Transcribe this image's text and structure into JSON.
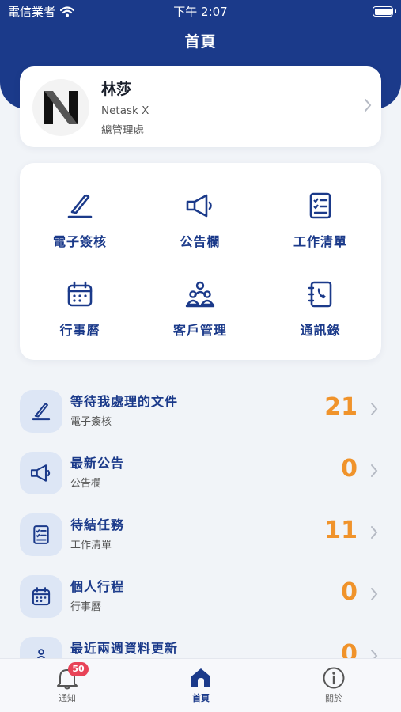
{
  "status_bar": {
    "carrier": "電信業者",
    "time": "下午 2:07"
  },
  "nav": {
    "title": "首頁"
  },
  "profile": {
    "name": "林莎",
    "company": "Netask X",
    "department": "總管理處"
  },
  "shortcuts": [
    {
      "label": "電子簽核",
      "icon": "pen-icon"
    },
    {
      "label": "公告欄",
      "icon": "megaphone-icon"
    },
    {
      "label": "工作清單",
      "icon": "checklist-icon"
    },
    {
      "label": "行事曆",
      "icon": "calendar-icon"
    },
    {
      "label": "客戶管理",
      "icon": "customers-icon"
    },
    {
      "label": "通訊錄",
      "icon": "contacts-icon"
    }
  ],
  "summary": [
    {
      "title": "等待我處理的文件",
      "subtitle": "電子簽核",
      "count": "21",
      "icon": "pen-icon"
    },
    {
      "title": "最新公告",
      "subtitle": "公告欄",
      "count": "0",
      "icon": "megaphone-icon"
    },
    {
      "title": "待結任務",
      "subtitle": "工作清單",
      "count": "11",
      "icon": "checklist-icon"
    },
    {
      "title": "個人行程",
      "subtitle": "行事曆",
      "count": "0",
      "icon": "calendar-icon"
    },
    {
      "title": "最近兩週資料更新",
      "subtitle": "",
      "count": "0",
      "icon": "customers-icon"
    }
  ],
  "tabs": [
    {
      "label": "通知",
      "badge": "50",
      "icon": "bell-icon"
    },
    {
      "label": "首頁",
      "icon": "home-icon"
    },
    {
      "label": "關於",
      "icon": "info-icon"
    }
  ],
  "colors": {
    "primary": "#1b3a8a",
    "accent": "#f0932b",
    "badge": "#e84357"
  }
}
